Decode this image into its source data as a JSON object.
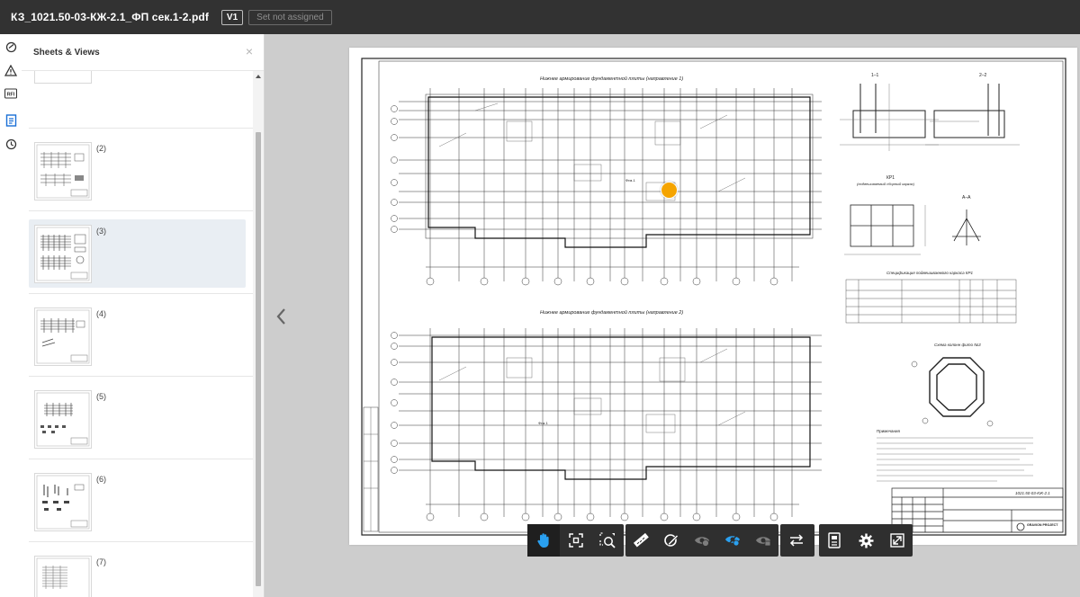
{
  "topbar": {
    "document_title": "КЗ_1021.50-03-КЖ-2.1_ФП сек.1-2.pdf",
    "version_badge": "V1",
    "set_status": "Set not assigned"
  },
  "rail": {
    "icons": [
      "feedback-icon",
      "warning-icon",
      "rfi-icon",
      "sheets-icon",
      "history-icon"
    ],
    "rfi_label": "RFI"
  },
  "panel": {
    "title": "Sheets & Views",
    "close_glyph": "×",
    "sheets": [
      {
        "label": "(2)"
      },
      {
        "label": "(3)",
        "active": true
      },
      {
        "label": "(4)"
      },
      {
        "label": "(5)"
      },
      {
        "label": "(6)"
      },
      {
        "label": "(7)"
      }
    ]
  },
  "viewer": {
    "accent_color": "#f5a400",
    "drawing": {
      "plan1_title": "Нижнее армирование фундаментной плиты (направление 1)",
      "plan2_title": "Нижнее армирование фундаментной плиты (направление 2)",
      "section_1": "1–1",
      "section_2": "2–2",
      "frame_title": "КР1",
      "frame_subtitle": "(подвешиваемый сборный каркас)",
      "section_a": "А–А",
      "spec_title": "Спецификация подвешиваемого каркаса КР1",
      "scheme_title": "Схема колонн фито №3",
      "notes_title": "Примечания",
      "stamp_code": "1021.50-03-КЖ-2.1",
      "stamp_org": "GRAVION PROJECT",
      "plan1_marker": "Фгм-1",
      "plan2_marker": "Фгм-1"
    }
  },
  "toolbar": {
    "group1": [
      "hand-tool-icon",
      "fit-view-icon",
      "zoom-area-icon"
    ],
    "group2": [
      "measure-icon",
      "markup-icon",
      "hide-markups-icon",
      "show-markups-icon",
      "markups-list-icon"
    ],
    "group3": [
      "compare-icon"
    ],
    "group4": [
      "sheet-info-icon",
      "settings-icon",
      "fullscreen-icon"
    ],
    "active_color": "#2aa0f0"
  }
}
